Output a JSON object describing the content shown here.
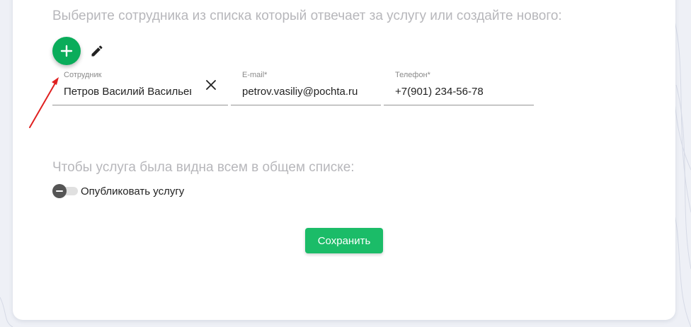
{
  "form": {
    "heading": "Выберите сотрудника из списка который отвечает за услугу или создайте нового:",
    "add_icon": "plus-icon",
    "edit_icon": "pencil-icon",
    "employee": {
      "label": "Сотрудник",
      "value": "Петров Василий Васильевич",
      "clear_icon": "close-icon"
    },
    "email": {
      "label": "E-mail*",
      "value": "petrov.vasiliy@pochta.ru"
    },
    "phone": {
      "label": "Телефон*",
      "value": "+7(901) 234-56-78"
    },
    "publish": {
      "heading": "Чтобы услуга была видна всем в общем списке:",
      "toggle_label": "Опубликовать услугу",
      "enabled": false
    },
    "save_label": "Сохранить"
  },
  "colors": {
    "accent": "#0aac5a",
    "save_button": "#1bbc68",
    "annotation_arrow": "#e02020",
    "background": "#eef0f6"
  }
}
